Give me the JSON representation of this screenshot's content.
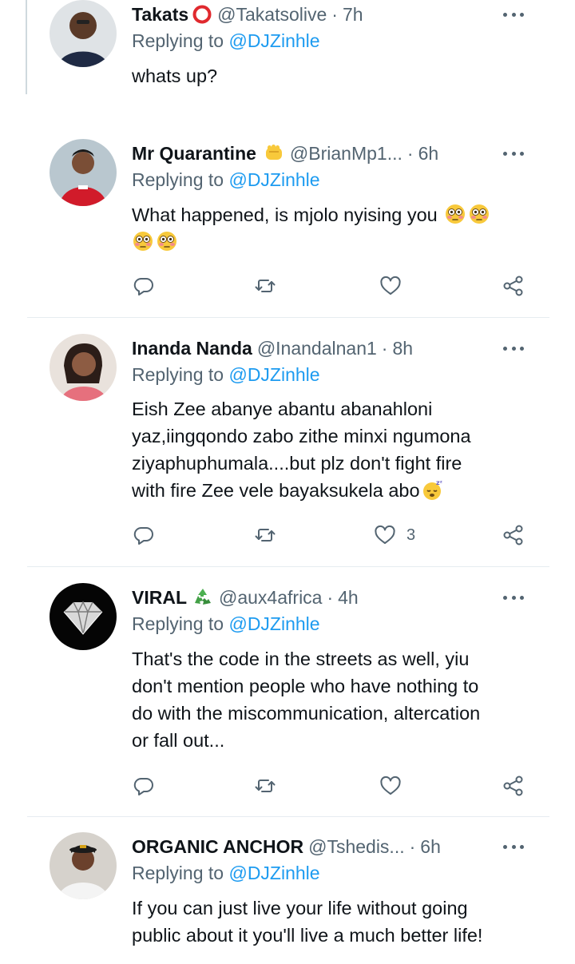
{
  "replying_prefix": "Replying to",
  "tweets": [
    {
      "name": "Takats",
      "badge": "red-ring-icon",
      "handle": "@Takatsolive",
      "dot": "·",
      "time": "7h",
      "mention": "@DJZinhle",
      "text": "whats up?"
    },
    {
      "name": "Mr Quarantine",
      "badge": "raised-fist-emoji-icon",
      "handle": "@BrianMp1...",
      "dot": "·",
      "time": "6h",
      "mention": "@DJZinhle",
      "text": "What happened, is mjolo nyising you",
      "emoji": "flushed-face-emoji-icon",
      "like_count": ""
    },
    {
      "name": "Inanda Nanda",
      "badge": "",
      "handle": "@Inandalnan1",
      "dot": "·",
      "time": "8h",
      "mention": "@DJZinhle",
      "text_lines": [
        "Eish Zee abanye abantu abanahloni",
        "yaz,iingqondo zabo zithe minxi ngumona",
        "ziyaphuphumala....but plz don't fight fire",
        "with fire Zee vele bayaksukela abo"
      ],
      "emoji": "sleeping-face-emoji-icon",
      "like_count": "3"
    },
    {
      "name": "VIRAL",
      "badge": "recycle-icon",
      "handle": "@aux4africa",
      "dot": "·",
      "time": "4h",
      "mention": "@DJZinhle",
      "text_lines": [
        "That's the code in the streets as well, yiu",
        "don't mention people who have nothing to",
        "do with the miscommunication, altercation",
        "or fall out..."
      ],
      "like_count": ""
    },
    {
      "name": "ORGANIC ANCHOR",
      "badge": "",
      "handle": "@Tshedis...",
      "dot": "·",
      "time": "6h",
      "mention": "@DJZinhle",
      "text_lines": [
        "If you can just live your life without going",
        "public about it you'll live a much better life!"
      ]
    }
  ],
  "icons": {
    "reply": "speech-bubble-icon",
    "retweet": "retweet-icon",
    "like": "heart-icon",
    "share": "share-icon",
    "more": "more-dots-icon"
  },
  "colors": {
    "text": "#0f1419",
    "secondary": "#536471",
    "link": "#1d9bf0",
    "divider": "#e6ecf0"
  }
}
